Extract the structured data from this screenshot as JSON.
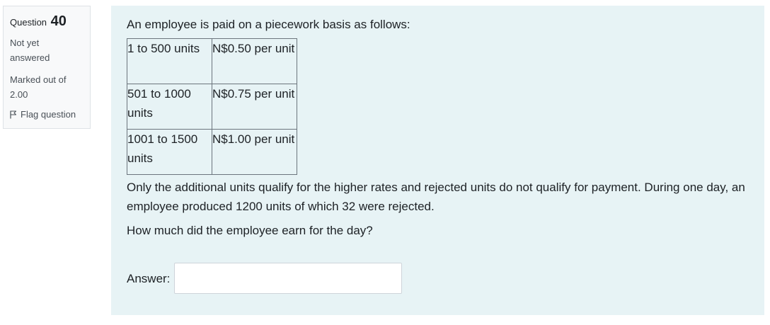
{
  "info": {
    "question_label": "Question",
    "question_number": "40",
    "state_line1": "Not yet",
    "state_line2": "answered",
    "grade_line1": "Marked out of",
    "grade_line2": "2.00",
    "flag_label": "Flag question"
  },
  "question": {
    "intro": "An employee is paid on a piecework basis as follows:",
    "table": [
      {
        "range": "1 to 500 units",
        "rate": "N$0.50 per unit"
      },
      {
        "range": "501 to 1000 units",
        "rate": "N$0.75 per unit"
      },
      {
        "range": "1001 to 1500 units",
        "rate": "N$1.00 per unit"
      }
    ],
    "details": "Only the additional units qualify for the higher rates and rejected units do not qualify for payment. During one day, an employee produced 1200 units of which 32 were rejected.",
    "prompt": "How much did the employee earn for the day?",
    "answer_label": "Answer:",
    "answer_value": ""
  }
}
